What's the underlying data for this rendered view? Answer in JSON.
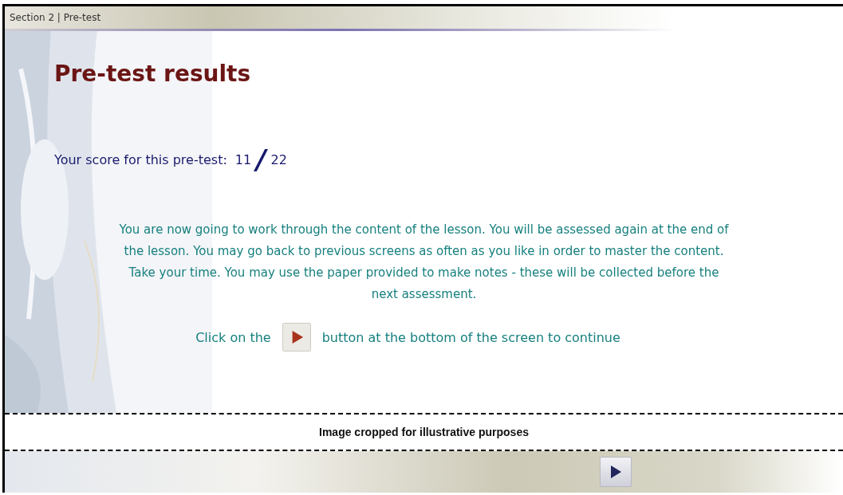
{
  "header": {
    "breadcrumb": "Section 2 | Pre-test"
  },
  "title": "Pre-test results",
  "score": {
    "label": "Your score for this pre-test:",
    "score": "11",
    "slash": "/",
    "total": "22"
  },
  "instructions": "You are now going to work through the content of the lesson.  You will be assessed again at the end of the lesson.  You may go back to previous screens as often as you like in order to master the content.  Take your time.  You may use the paper provided to make notes - these will be collected before the next assessment.",
  "continue_hint": {
    "before": "Click on the",
    "after": "button at the bottom of the screen to continue"
  },
  "crop_note": "Image cropped for illustrative purposes"
}
